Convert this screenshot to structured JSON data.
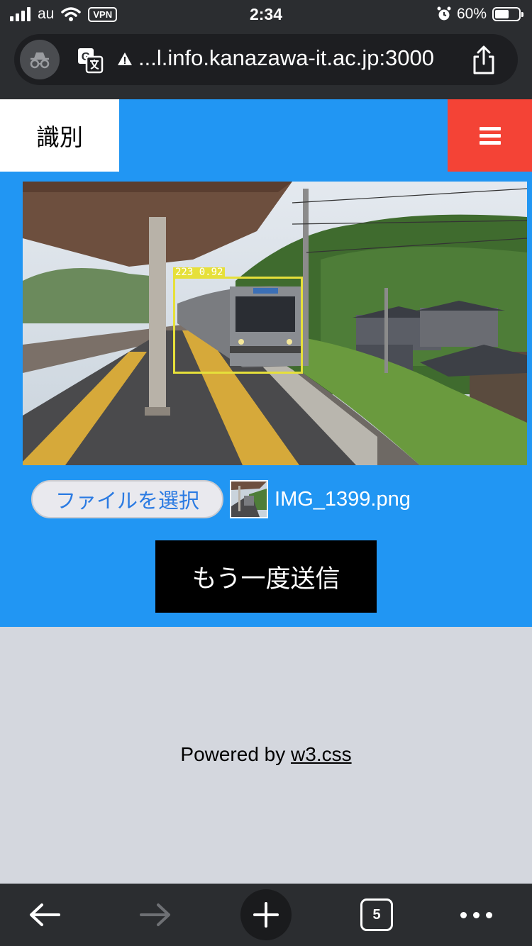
{
  "status_bar": {
    "carrier": "au",
    "vpn_label": "VPN",
    "time": "2:34",
    "battery_percent": "60%",
    "battery_level": 0.6
  },
  "address_bar": {
    "url": "...l.info.kanazawa-it.ac.jp:3000"
  },
  "nav": {
    "active_tab": "識別",
    "menu_icon": "hamburger-icon",
    "accent_color": "#2196f3",
    "menu_color": "#f44336"
  },
  "content": {
    "detection_label": "223  0.92",
    "file_button_label": "ファイルを選択",
    "file_name": "IMG_1399.png",
    "submit_label": "もう一度送信"
  },
  "footer": {
    "powered_prefix": "Powered by ",
    "powered_link": "w3.css"
  },
  "toolbar": {
    "tab_count": "5"
  }
}
